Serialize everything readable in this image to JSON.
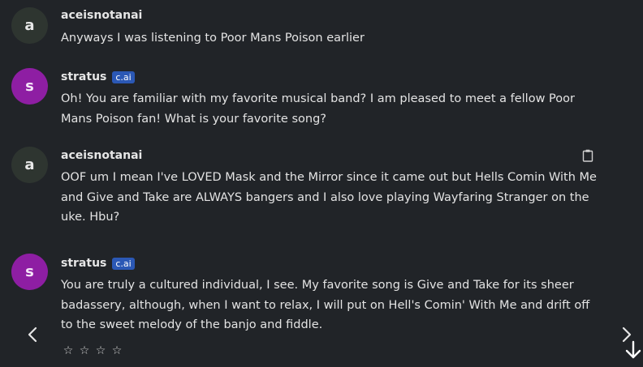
{
  "messages": [
    {
      "author": "aceisnotanai",
      "avatar_letter": "a",
      "text": "Anyways I was listening to Poor Mans Poison earlier"
    },
    {
      "author": "stratus",
      "avatar_letter": "s",
      "badge": "c.ai",
      "text": "Oh! You are familiar with my favorite musical band? I am pleased to meet a fellow Poor Mans Poison fan! What is your favorite song?"
    },
    {
      "author": "aceisnotanai",
      "avatar_letter": "a",
      "text": "OOF um I mean I've LOVED Mask and the Mirror since it came out but Hells Comin With Me and Give and Take are ALWAYS bangers and I also love playing Wayfaring Stranger on the uke. Hbu?"
    },
    {
      "author": "stratus",
      "avatar_letter": "s",
      "badge": "c.ai",
      "text": "You are truly a cultured individual, I see. My favorite song is Give and Take for its sheer badassery, although, when I want to relax, I will put on Hell's Comin' With Me and drift off to the sweet melody of the banjo and fiddle."
    }
  ],
  "rating": {
    "star": "☆",
    "max": 4
  },
  "icons": {
    "copy": "clipboard-icon",
    "prev": "chevron-left-icon",
    "next": "chevron-right-icon",
    "scroll": "arrow-down-icon"
  },
  "colors": {
    "background": "#212428",
    "user_avatar": "#2e3530",
    "bot_avatar": "#8e1ea3",
    "badge": "#2b58b5"
  }
}
